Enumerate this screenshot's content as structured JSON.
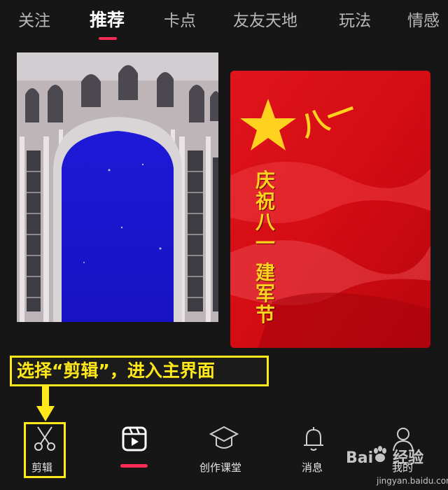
{
  "top_tabs": {
    "items": [
      {
        "label": "关注"
      },
      {
        "label": "推荐"
      },
      {
        "label": "卡点"
      },
      {
        "label": "友友天地"
      },
      {
        "label": "玩法"
      },
      {
        "label": "情感"
      }
    ],
    "active_index": 1
  },
  "cards": {
    "right": {
      "vertical_text": [
        "庆",
        "祝",
        "八",
        "一",
        "",
        "建",
        "军",
        "节"
      ],
      "emblem_text": "八一"
    }
  },
  "annotation": {
    "text": "选择“剪辑”，进入主界面",
    "color": "#ffe81a"
  },
  "bottom_nav": {
    "items": [
      {
        "label": "剪辑",
        "icon": "scissors-icon"
      },
      {
        "label": "",
        "icon": "clapperboard-play-icon"
      },
      {
        "label": "创作课堂",
        "icon": "graduation-cap-icon"
      },
      {
        "label": "消息",
        "icon": "bell-icon"
      },
      {
        "label": "我的",
        "icon": "person-icon"
      }
    ],
    "active_index": 1
  },
  "watermark": {
    "brand": "Bai",
    "brand_suffix": "经验",
    "url": "jingyan.baidu.com"
  },
  "colors": {
    "accent": "#fe2c55",
    "highlight": "#ffe81a",
    "background": "#161616"
  }
}
